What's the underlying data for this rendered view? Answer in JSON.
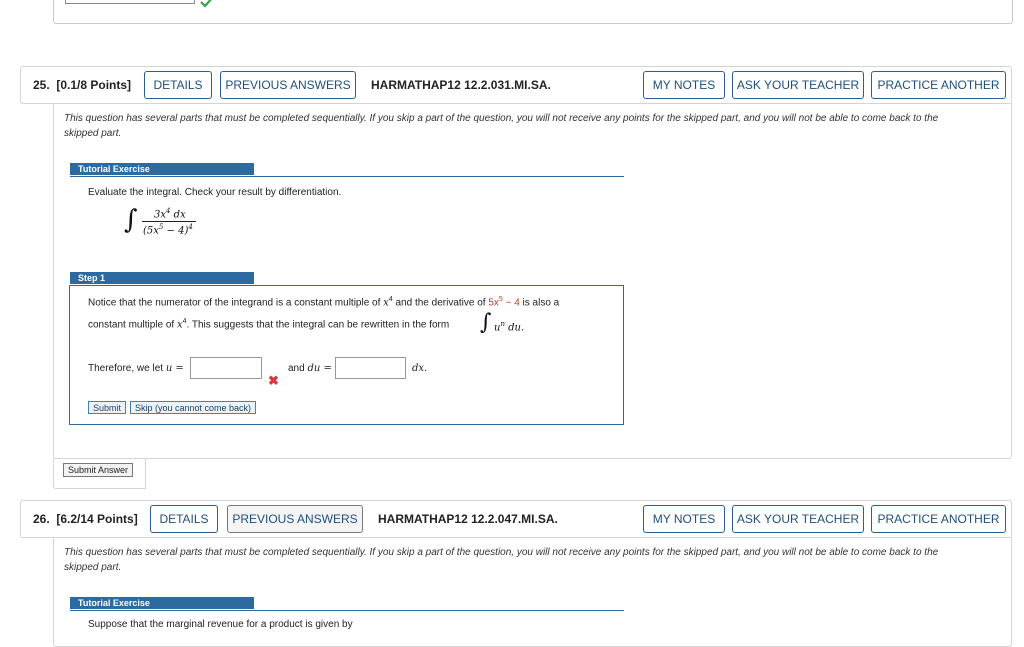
{
  "prev_question": {
    "status_icon": "check-icon",
    "status_color": "#3aa144"
  },
  "q25": {
    "number": "25.",
    "points": "[0.1/8 Points]",
    "details": "DETAILS",
    "previous_answers": "PREVIOUS ANSWERS",
    "ref": "HARMATHAP12 12.2.031.MI.SA.",
    "my_notes": "MY NOTES",
    "ask_teacher": "ASK YOUR TEACHER",
    "practice_another": "PRACTICE ANOTHER",
    "notice_line1": "This question has several parts that must be completed sequentially. If you skip a part of the question, you will not receive any points for the skipped part, and you will not be able to come back to the",
    "notice_line2": "skipped part.",
    "tutorial_label": "Tutorial Exercise",
    "instruction": "Evaluate the integral. Check your result by differentiation.",
    "integral": {
      "numerator": "3x",
      "numerator_exp": "4",
      "numerator_tail": " dx",
      "denominator": "(5x",
      "denominator_exp": "5",
      "denominator_tail": " − 4)",
      "outer_exp": "4"
    },
    "step_label": "Step 1",
    "step_text1_a": "Notice that the numerator of the integrand is a constant multiple of ",
    "step_text1_var": "x",
    "step_text1_exp": "4",
    "step_text1_b": " and the derivative of ",
    "step_text1_red": "5x",
    "step_text1_red_exp": "5",
    "step_text1_red_tail": " − 4",
    "step_text1_c": " is also a",
    "step_text2_a": "constant multiple of ",
    "step_text2_var": "x",
    "step_text2_exp": "4",
    "step_text2_b": ". This suggests that the integral can be rewritten in the form",
    "step_form_u": "u",
    "step_form_n": "n",
    "step_form_du": " du.",
    "therefore": "Therefore, we let ",
    "u_eq": "u =",
    "u_value": "",
    "and_du": "and ",
    "du_eq": "du =",
    "du_value": "",
    "dx": "dx.",
    "submit": "Submit",
    "skip": "Skip (you cannot come back)",
    "submit_answer": "Submit Answer",
    "u_status_icon": "x-mark-icon",
    "error_color": "#d9363e"
  },
  "q26": {
    "number": "26.",
    "points": "[6.2/14 Points]",
    "details": "DETAILS",
    "previous_answers": "PREVIOUS ANSWERS",
    "ref": "HARMATHAP12 12.2.047.MI.SA.",
    "my_notes": "MY NOTES",
    "ask_teacher": "ASK YOUR TEACHER",
    "practice_another": "PRACTICE ANOTHER",
    "notice_line1": "This question has several parts that must be completed sequentially. If you skip a part of the question, you will not receive any points for the skipped part, and you will not be able to come back to the",
    "notice_line2": "skipped part.",
    "tutorial_label": "Tutorial Exercise",
    "instruction": "Suppose that the marginal revenue for a product is given by"
  },
  "colors": {
    "accent": "#2c6aa0",
    "button_text": "#1e4f7c"
  }
}
